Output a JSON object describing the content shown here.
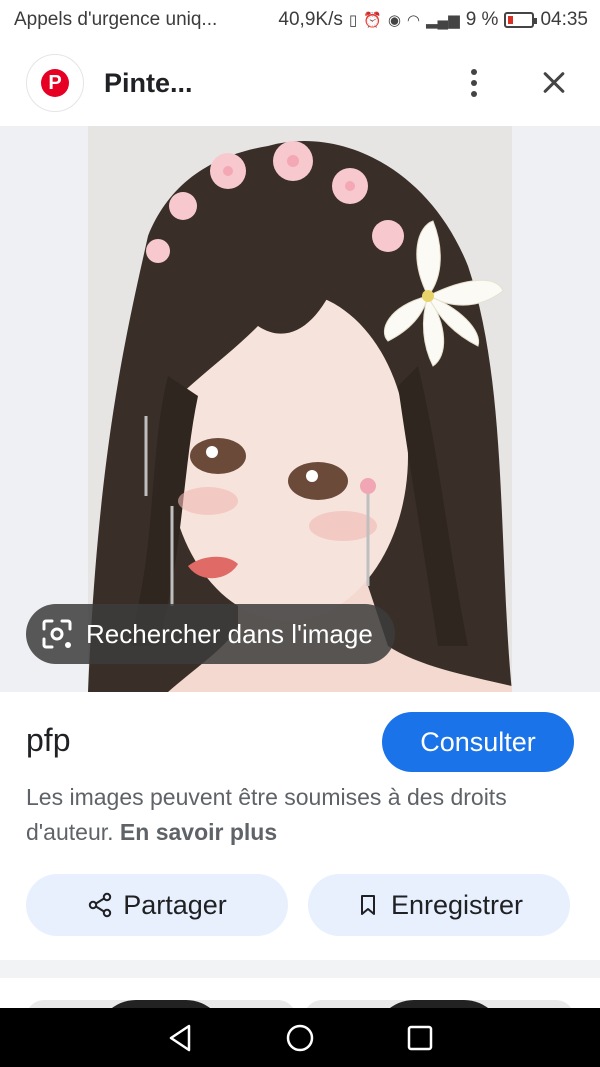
{
  "status_bar": {
    "notification": "Appels d'urgence uniq...",
    "network_speed": "40,9K/s",
    "battery_percent": "9 %",
    "time": "04:35",
    "icons": [
      "vibrate-icon",
      "alarm-icon",
      "eye-icon",
      "wifi-icon",
      "signal-icon",
      "battery-icon"
    ]
  },
  "app_bar": {
    "site_logo": "P",
    "title": "Pinte...",
    "icons": [
      "pinterest-logo-icon",
      "more-vert-icon",
      "close-icon"
    ]
  },
  "image": {
    "lens_label": "Rechercher dans l'image",
    "lens_icon": "lens-search-icon"
  },
  "info": {
    "title": "pfp",
    "visit_label": "Consulter",
    "copyright_text": "Les images peuvent être soumises à des droits d'auteur.",
    "learn_more": "En savoir plus",
    "share_label": "Partager",
    "save_label": "Enregistrer",
    "share_icon": "share-icon",
    "save_icon": "bookmark-icon"
  },
  "nav_bar": {
    "icons": [
      "back-triangle-icon",
      "home-circle-icon",
      "recents-square-icon"
    ]
  },
  "colors": {
    "accent": "#1a73e8",
    "pill_bg": "#e8f0fe",
    "pinterest_red": "#e60023"
  }
}
